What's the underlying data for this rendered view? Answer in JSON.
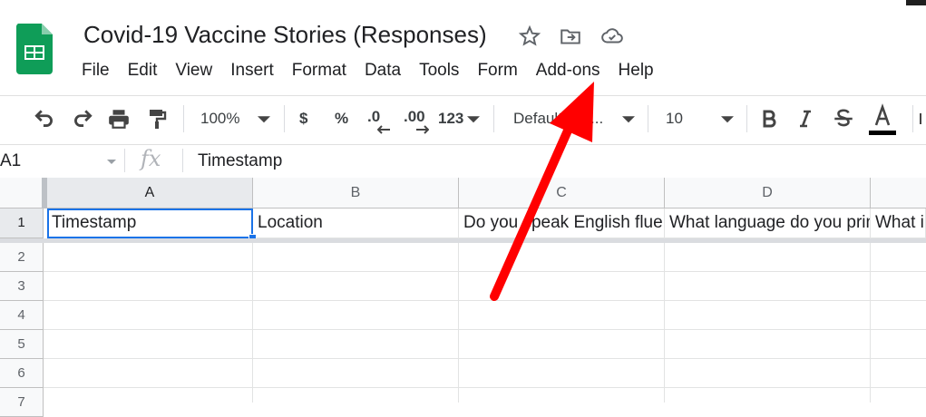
{
  "doc": {
    "title": "Covid-19 Vaccine Stories (Responses)"
  },
  "menu": [
    "File",
    "Edit",
    "View",
    "Insert",
    "Format",
    "Data",
    "Tools",
    "Form",
    "Add-ons",
    "Help"
  ],
  "toolbar": {
    "zoom": "100%",
    "currency": "$",
    "percent": "%",
    "dec_decrease": ".0",
    "dec_increase": ".00",
    "more_formats": "123",
    "font": "Default (Ari...",
    "font_size": "10"
  },
  "formula_bar": {
    "cell_ref": "A1",
    "fx": "fx",
    "value": "Timestamp"
  },
  "columns": [
    "A",
    "B",
    "C",
    "D"
  ],
  "rows": [
    "1",
    "2",
    "3",
    "4",
    "5",
    "6",
    "7"
  ],
  "row1": [
    "Timestamp",
    "Location",
    "Do you speak English fluently?",
    "What language do you primarily speak?",
    "What i"
  ]
}
